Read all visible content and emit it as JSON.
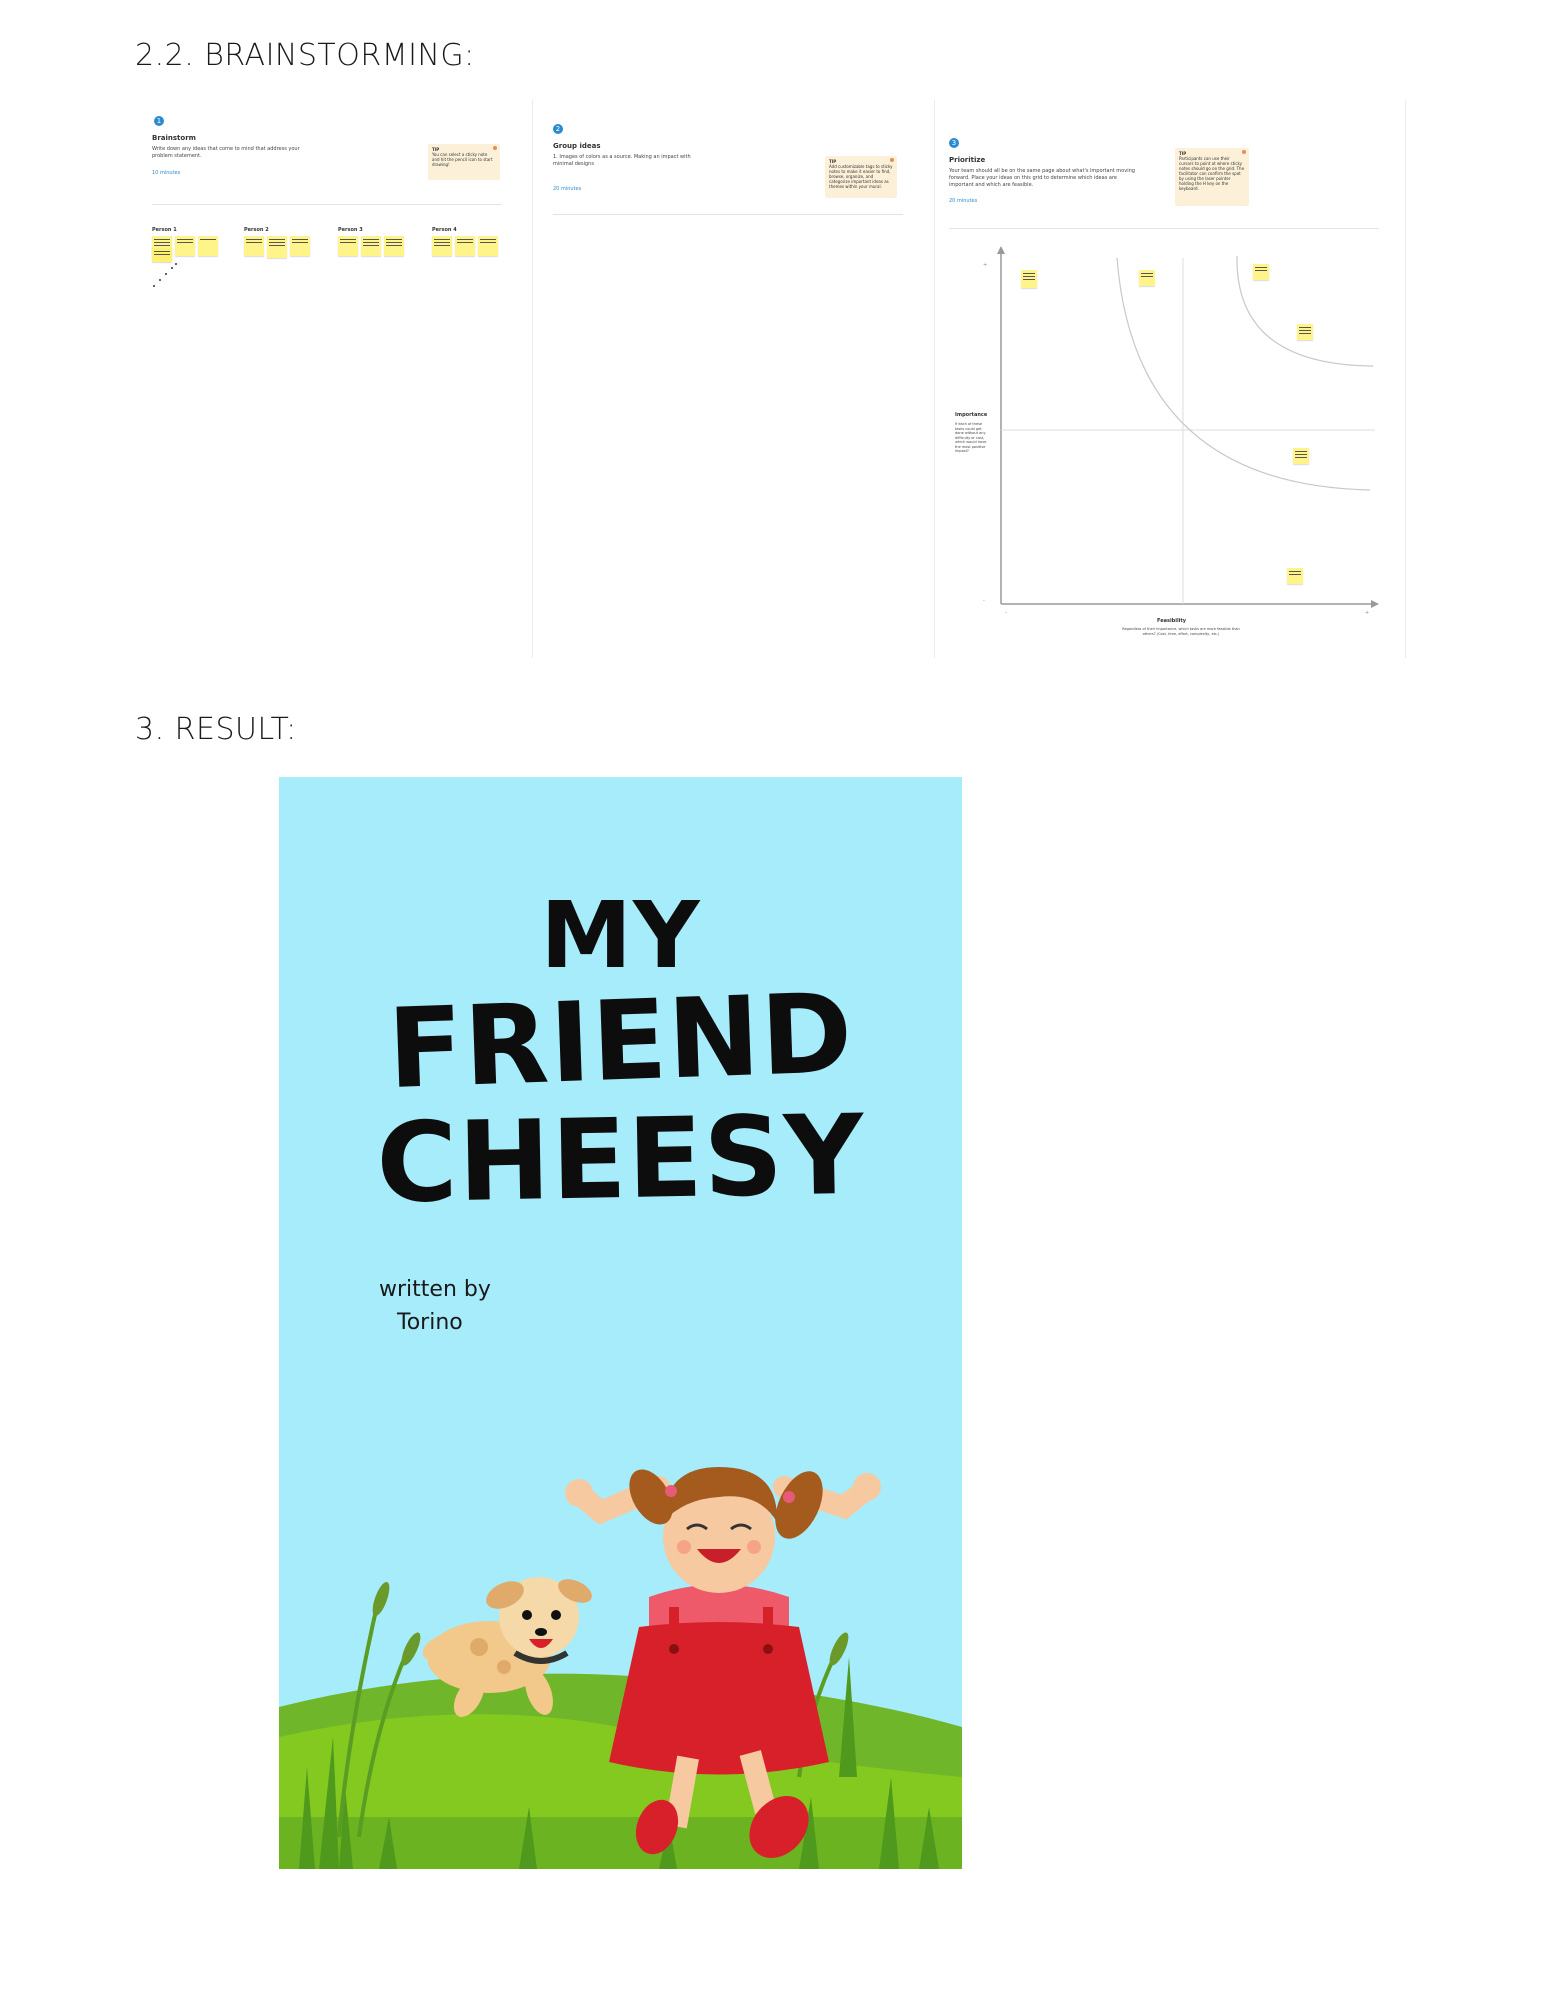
{
  "sections": {
    "brainstorming_heading": "2.2. BRAINSTORMING:",
    "result_heading": "3. RESULT:"
  },
  "boards": {
    "brainstorm": {
      "step": "1",
      "title": "Brainstorm",
      "description": "Write down any ideas that come to mind that address your problem statement.",
      "minutes": "10 minutes",
      "tip_label": "TIP",
      "tip": "You can select a sticky note and hit the pencil icon to start drawing!",
      "columns": [
        "Person 1",
        "Person 2",
        "Person 3",
        "Person 4"
      ]
    },
    "group_ideas": {
      "step": "2",
      "title": "Group ideas",
      "description": "1. Images of colors as a source. Making an impact with minimal designs",
      "minutes": "20 minutes",
      "tip_label": "TIP",
      "tip": "Add customizable tags to sticky notes to make it easier to find, browse, organize, and categorize important ideas as themes within your mural."
    },
    "prioritize": {
      "step": "3",
      "title": "Prioritize",
      "description": "Your team should all be on the same page about what's important moving forward. Place your ideas on this grid to determine which ideas are important and which are feasible.",
      "minutes": "20 minutes",
      "tip_label": "TIP",
      "tip": "Participants can use their cursors to point at where sticky notes should go on the grid. The facilitator can confirm the spot by using the laser pointer holding the H key on the keyboard.",
      "y_label": "Importance",
      "y_desc": "If each of these tasks could get done without any difficulty or cost, which would have the most positive impact?",
      "x_label": "Feasibility",
      "x_desc": "Regardless of their importance, which tasks are more feasible than others? (Cost, time, effort, complexity, etc.)"
    }
  },
  "cover": {
    "title_line1": "MY",
    "title_line2": "FRIEND",
    "title_line3": "CHEESY",
    "written_by": "written by",
    "author": "Torino",
    "colors": {
      "sky": "#a6ecfa",
      "grass": "#7cc321",
      "dress": "#d8202a"
    }
  }
}
